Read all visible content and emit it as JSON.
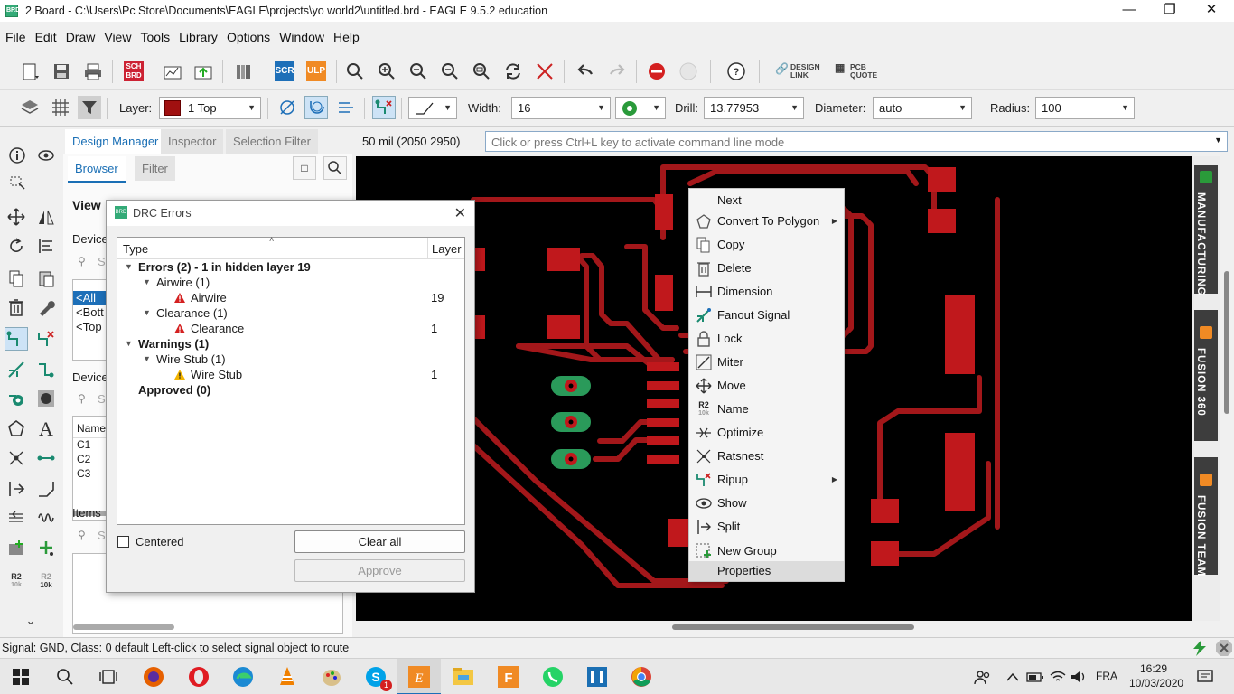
{
  "window": {
    "title": "2 Board - C:\\Users\\Pc Store\\Documents\\EAGLE\\projects\\yo world2\\untitled.brd - EAGLE 9.5.2 education",
    "app_icon_text": "BRD"
  },
  "menu": [
    "File",
    "Edit",
    "Draw",
    "View",
    "Tools",
    "Library",
    "Options",
    "Window",
    "Help"
  ],
  "toolbar1": {
    "sch_label": "SCH BRD",
    "scr_label": "SCR",
    "ulp_label": "ULP",
    "design_link": "DESIGN LINK",
    "pcb_quote": "PCB QUOTE"
  },
  "toolbar2": {
    "layer_label": "Layer:",
    "layer_value": "1 Top",
    "layer_color": "#a01010",
    "width_label": "Width:",
    "width_value": "16",
    "drill_label": "Drill:",
    "drill_value": "13.77953",
    "diameter_label": "Diameter:",
    "diameter_value": "auto",
    "radius_label": "Radius:",
    "radius_value": "100"
  },
  "design_manager": {
    "tabs": [
      "Design Manager",
      "Inspector",
      "Selection Filter"
    ],
    "subtabs": [
      "Browser",
      "Filter"
    ],
    "view_label": "View",
    "device_label": "Device",
    "devices_label": "Devices",
    "items_label": "Items",
    "name_header": "Name",
    "search_placeholder": "S",
    "list1": [
      "<All D",
      "<Bott",
      "<Top"
    ],
    "list2": [
      "C1",
      "C2",
      "C3"
    ]
  },
  "command_bar": {
    "coords": "50 mil (2050 2950)",
    "placeholder": "Click or press Ctrl+L key to activate command line mode"
  },
  "drc": {
    "title": "DRC Errors",
    "col_type": "Type",
    "col_layer": "Layer",
    "rows": [
      {
        "text": "Errors (2) - 1 in hidden layer 19",
        "layer": ""
      },
      {
        "text": "Airwire (1)",
        "layer": ""
      },
      {
        "text": "Airwire",
        "layer": "19"
      },
      {
        "text": "Clearance (1)",
        "layer": ""
      },
      {
        "text": "Clearance",
        "layer": "1"
      },
      {
        "text": "Warnings (1)",
        "layer": ""
      },
      {
        "text": "Wire Stub (1)",
        "layer": ""
      },
      {
        "text": "Wire Stub",
        "layer": "1"
      },
      {
        "text": "Approved (0)",
        "layer": ""
      }
    ],
    "centered_label": "Centered",
    "clear_all": "Clear all",
    "approve": "Approve"
  },
  "context_menu": [
    {
      "label": "Next",
      "icon": "none",
      "submenu": false
    },
    {
      "label": "Convert To Polygon",
      "icon": "pentagon-icon",
      "submenu": true
    },
    {
      "label": "Copy",
      "icon": "copy-icon",
      "submenu": false
    },
    {
      "label": "Delete",
      "icon": "trash-icon",
      "submenu": false
    },
    {
      "label": "Dimension",
      "icon": "dimension-icon",
      "submenu": false
    },
    {
      "label": "Fanout Signal",
      "icon": "fanout-icon",
      "submenu": false
    },
    {
      "label": "Lock",
      "icon": "lock-icon",
      "submenu": false
    },
    {
      "label": "Miter",
      "icon": "miter-icon",
      "submenu": false
    },
    {
      "label": "Move",
      "icon": "move-icon",
      "submenu": false
    },
    {
      "label": "Name",
      "icon": "name-icon",
      "submenu": false
    },
    {
      "label": "Optimize",
      "icon": "optimize-icon",
      "submenu": false
    },
    {
      "label": "Ratsnest",
      "icon": "ratsnest-icon",
      "submenu": false
    },
    {
      "label": "Ripup",
      "icon": "ripup-icon",
      "submenu": true
    },
    {
      "label": "Show",
      "icon": "eye-icon",
      "submenu": false
    },
    {
      "label": "Split",
      "icon": "split-icon",
      "submenu": false
    },
    {
      "label": "New Group",
      "icon": "group-icon",
      "submenu": false
    },
    {
      "label": "Properties",
      "icon": "none",
      "submenu": false
    }
  ],
  "side_tabs": [
    "MANUFACTURING",
    "FUSION 360",
    "FUSION TEAM"
  ],
  "status_text": "Signal: GND, Class: 0 default Left-click to select signal object to route",
  "taskbar": {
    "language": "FRA",
    "time": "16:29",
    "date": "10/03/2020",
    "skype_badge": "1"
  },
  "palette": {
    "r2_label": "R2",
    "r2_sub": "10k"
  },
  "colors": {
    "trace": "#a3171a",
    "pad": "#c0181c",
    "via_green": "#2a9a5a",
    "accent": "#1a6fb5"
  }
}
